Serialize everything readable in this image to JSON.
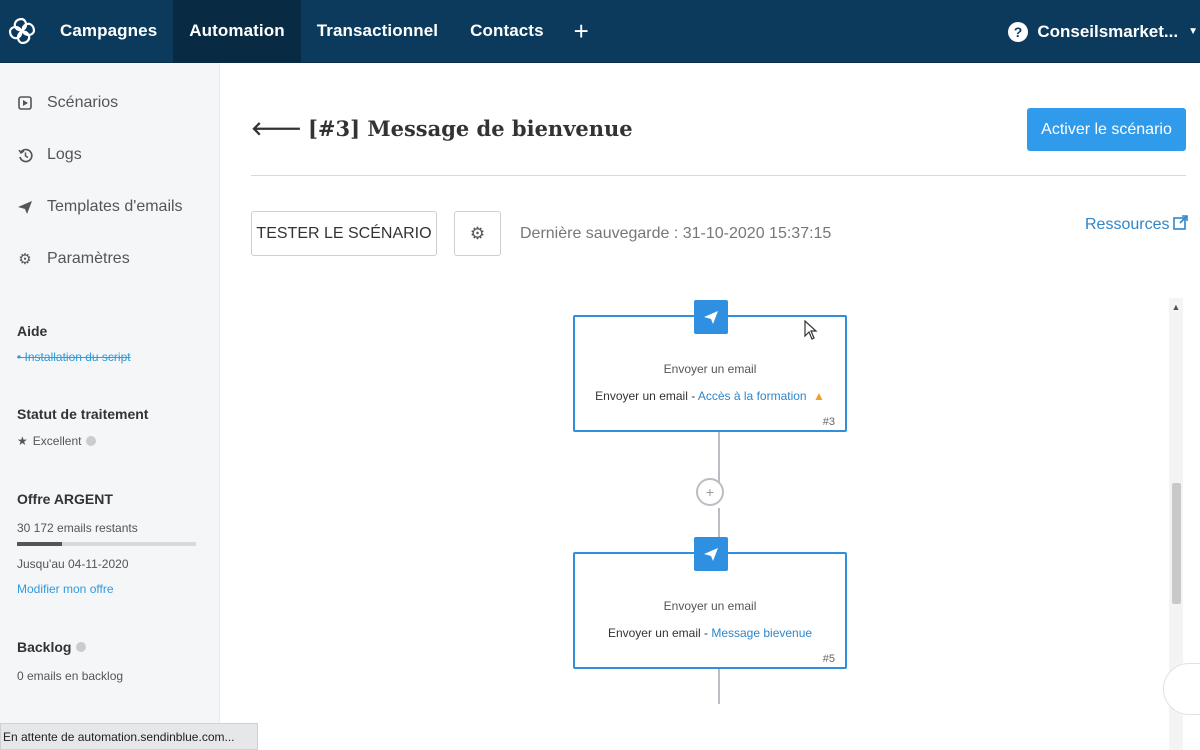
{
  "nav": {
    "items": [
      "Campagnes",
      "Automation",
      "Transactionnel",
      "Contacts"
    ],
    "plus": "+",
    "help": "?",
    "account": "Conseilsmarket..."
  },
  "sidebar": {
    "menu": [
      {
        "label": "Scénarios",
        "icon": "play-square-icon"
      },
      {
        "label": "Logs",
        "icon": "history-icon"
      },
      {
        "label": "Templates d'emails",
        "icon": "paper-plane-icon"
      },
      {
        "label": "Paramètres",
        "icon": "gear-icon"
      }
    ],
    "aide": {
      "title": "Aide",
      "link": "Installation du script"
    },
    "statut": {
      "title": "Statut de traitement",
      "value": "Excellent"
    },
    "offre": {
      "title": "Offre ARGENT",
      "remaining": "30 172 emails restants",
      "progress_percent": 25,
      "until": "Jusqu'au 04-11-2020",
      "modify": "Modifier mon offre"
    },
    "backlog": {
      "title": "Backlog",
      "value": "0 emails en backlog"
    }
  },
  "main": {
    "title": "[#3] Message de bienvenue",
    "activate_button": "Activer le scénario",
    "test_button": "TESTER LE SCÉNARIO",
    "last_saved": "Dernière sauvegarde : 31-10-2020 15:37:15",
    "resources": "Ressources"
  },
  "nodes": [
    {
      "title": "Envoyer un email",
      "desc_prefix": "Envoyer un email - ",
      "desc_link": "Accès à la formation",
      "warning": true,
      "number": "#3"
    },
    {
      "title": "Envoyer un email",
      "desc_prefix": "Envoyer un email - ",
      "desc_link": "Message bievenue",
      "warning": false,
      "number": "#5"
    }
  ],
  "statusbar": {
    "text": "En attente de automation.sendinblue.com..."
  },
  "colors": {
    "nav_bg": "#0b3a5c",
    "primary": "#2f9bea",
    "link": "#2f86c9",
    "warning": "#f0a030"
  }
}
